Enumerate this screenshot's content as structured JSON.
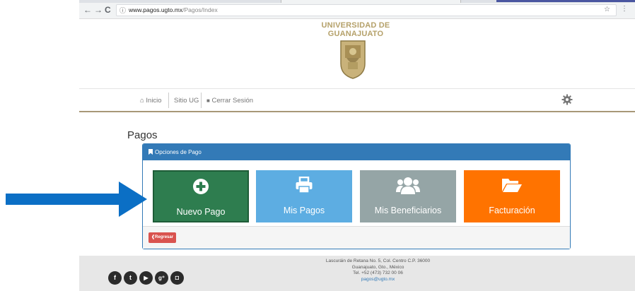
{
  "browser": {
    "url_host": "www.pagos.ugto.mx",
    "url_path": "/Pagos/Index",
    "back_icon": "←",
    "forward_icon": "→",
    "reload_icon": "C",
    "info_icon": "ⓘ",
    "star_icon": "☆",
    "menu_icon": "⋮"
  },
  "header": {
    "title_line1": "UNIVERSIDAD DE",
    "title_line2": "GUANAJUATO"
  },
  "nav": {
    "home": "Inicio",
    "site": "Sitio UG",
    "logout": "Cerrar Sesión",
    "home_icon": "⌂",
    "lock_icon": "🔒"
  },
  "page": {
    "title": "Pagos",
    "panel_title": "Opciones de Pago",
    "back_button": "Regresar"
  },
  "tiles": [
    {
      "label": "Nuevo Pago",
      "color": "#2e7d4f",
      "icon": "plus-circle-icon"
    },
    {
      "label": "Mis Pagos",
      "color": "#5dade2",
      "icon": "printer-icon"
    },
    {
      "label": "Mis Beneficiarios",
      "color": "#95a5a6",
      "icon": "users-icon"
    },
    {
      "label": "Facturación",
      "color": "#ff7300",
      "icon": "folder-open-icon"
    }
  ],
  "footer": {
    "address1": "Lascuráin de Retana No. 5, Col. Centro C.P. 36000",
    "address2": "Guanajuato, Gto., México",
    "phone": "Tel. +52 (473) 732 00 06",
    "email": "pagos@ugto.mx",
    "social": [
      {
        "name": "facebook-icon",
        "glyph": "f"
      },
      {
        "name": "twitter-icon",
        "glyph": "t"
      },
      {
        "name": "youtube-icon",
        "glyph": "▶"
      },
      {
        "name": "googleplus-icon",
        "glyph": "g⁺"
      },
      {
        "name": "instagram-icon",
        "glyph": "◘"
      }
    ]
  },
  "colors": {
    "brand_gold": "#b5a16a",
    "primary_blue": "#337ab7",
    "danger_red": "#d9534f",
    "arrow_blue": "#0b6fc5"
  }
}
